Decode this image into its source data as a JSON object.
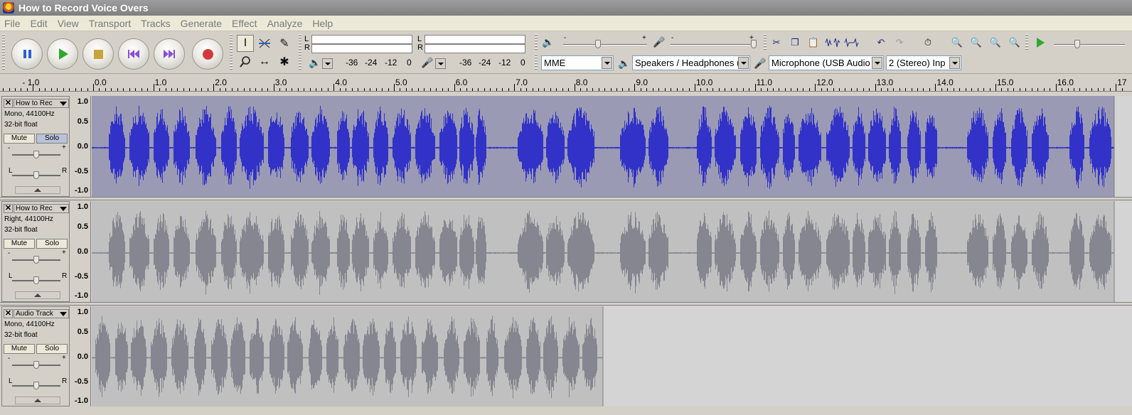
{
  "window": {
    "title": "How to Record Voice Overs"
  },
  "menu": [
    "File",
    "Edit",
    "View",
    "Transport",
    "Tracks",
    "Generate",
    "Effect",
    "Analyze",
    "Help"
  ],
  "transport": {
    "buttons": [
      "pause",
      "play",
      "stop",
      "skip-to-start",
      "skip-to-end",
      "record"
    ]
  },
  "tools": [
    "selection",
    "envelope",
    "draw",
    "zoom",
    "time-shift",
    "multi"
  ],
  "meters": {
    "playback_channels": [
      "L",
      "R"
    ],
    "record_channels": [
      "L",
      "R"
    ],
    "scale": [
      "-36",
      "-24",
      "-12",
      "0"
    ]
  },
  "devices": {
    "host": "MME",
    "output": "Speakers / Headphones (",
    "input": "Microphone (USB Audio D",
    "input_channels": "2 (Stereo) Inp"
  },
  "ruler": {
    "labels": [
      "- 1.0",
      "0.0",
      "1.0",
      "2.0",
      "3.0",
      "4.0",
      "5.0",
      "6.0",
      "7.0",
      "8.0",
      "9.0",
      "10.0",
      "11.0",
      "12.0",
      "13.0",
      "14.0",
      "15.0",
      "16.0",
      "17"
    ]
  },
  "tracks": [
    {
      "name": "How to Rec",
      "info1": "Mono, 44100Hz",
      "info2": "32-bit float",
      "mute": "Mute",
      "solo": "Solo",
      "selected": true,
      "wave_color": "#3232c8",
      "bg_color": "#9a9ab4",
      "clip_end_seconds": 17
    },
    {
      "name": "How to Rec",
      "info1": "Right, 44100Hz",
      "info2": "32-bit float",
      "mute": "Mute",
      "solo": "Solo",
      "selected": false,
      "wave_color": "#868690",
      "bg_color": "#c0c0c0",
      "clip_end_seconds": 17
    },
    {
      "name": "Audio Track",
      "info1": "Mono, 44100Hz",
      "info2": "32-bit float",
      "mute": "Mute",
      "solo": "Solo",
      "selected": false,
      "wave_color": "#868690",
      "bg_color": "#c0c0c0",
      "clip_end_seconds": 8.5
    }
  ],
  "amplitude_labels": [
    "1.0",
    "0.5",
    "0.0",
    "-0.5",
    "-1.0"
  ],
  "slider_marks": {
    "gain_minus": "-",
    "gain_plus": "+",
    "pan_left": "L",
    "pan_right": "R"
  }
}
